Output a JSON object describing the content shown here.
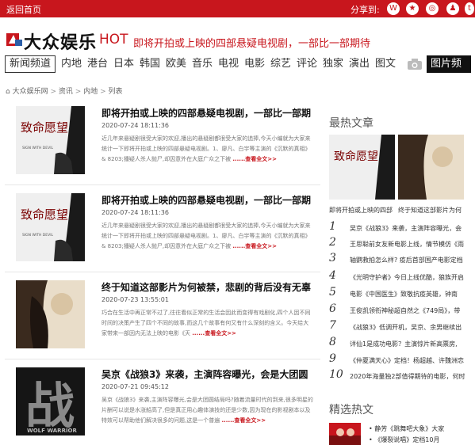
{
  "topbar": {
    "home_label": "返回首页",
    "share_label": "分享到:",
    "share_icons": [
      "weibo-icon",
      "qzone-icon",
      "wechat-icon",
      "qq-icon",
      "tencent-weibo-icon"
    ],
    "brand_color": "#c8161d"
  },
  "brand": {
    "logo_text": "大众娱乐",
    "hot_label": "HOT",
    "hot_title": "即将开拍或上映的四部悬疑电视剧，一部比一部期待"
  },
  "nav": {
    "items": [
      "新闻频道",
      "内地",
      "港台",
      "日本",
      "韩国",
      "欧美",
      "音乐",
      "电视",
      "电影",
      "综艺",
      "评论",
      "独家",
      "演出",
      "图文"
    ],
    "photo_label": "图片频道"
  },
  "breadcrumb": {
    "items": [
      "大众娱乐网",
      "资讯",
      "内地",
      "列表"
    ],
    "separator": ">"
  },
  "articles": [
    {
      "title": "即将开拍或上映的四部悬疑电视剧，一部比一部期",
      "date": "2020-07-24 18:11:36",
      "summary": "近几年来悬疑剧很受大家的欢迎,播出的悬疑剧都很受大家的追捧,今天小编就为大家来统计一下即将开拍或上映的四部悬疑电视剧。1、廖凡、白宇等主演的《沉默的真相》& 8203;播疑人杀人抛尸,却因意外在大庭广众之下被",
      "more": "......查看全文>>",
      "thumb_text": "致命愿望",
      "thumb_sub": "SIGN WITH DEVIL"
    },
    {
      "title": "即将开拍或上映的四部悬疑电视剧，一部比一部期",
      "date": "2020-07-24 18:11:36",
      "summary": "近几年来悬疑剧很受大家的欢迎,播出的悬疑剧都很受大家的追捧,今天小编就为大家来统计一下即将开拍或上映的四部悬疑电视剧。1、廖凡、白宇等主演的《沉默的真相》& 8203;播疑人杀人抛尸,却因意外在大庭广众之下被",
      "more": "......查看全文>>",
      "thumb_text": "致命愿望",
      "thumb_sub": "SIGN WITH DEVIL"
    },
    {
      "title": "终于知道这部影片为何被禁，悲剧的背后没有无辜",
      "date": "2020-07-23 13:55:01",
      "summary": "巧合在生活中再正常不过了,往往看似正常的生活会因此而变得有戏剧化,四个人因不同时间的决策产生了四个不同的故事,而这几个故事有何又有什么深刻的含义。今天给大家带来一部因内无法上映的电影《天",
      "more": "......查看全文>>",
      "thumb_text": "",
      "thumb_sub": ""
    },
    {
      "title": "吴京《战狼3》来袭，主演阵容曝光，会是大团圆",
      "date": "2020-07-21 09:45:12",
      "summary": "吴京《战狼3》来袭,主演阵容曝光,会是大团圆结局吗?随着流量时代的到来,很多明星的片酬可以说是水涨船高了,但是真正用心趣体演技的还是少数,因为现在的影视剧本以及特效可以帮助他们解决很多的问题,这是一个普遍",
      "more": "......查看全文>>",
      "thumb_text": "战",
      "thumb_sub": "WOLF WARRIOR"
    }
  ],
  "sidebar": {
    "hot_title": "最热文章",
    "hot_captions": [
      "即将开拍或上映的四部",
      "终于知道这部影片为何"
    ],
    "ranks": [
      "吴京《战狼3》来袭，主演阵容曝光，会",
      "王思聪前女友新电影上线，情节模仿《雨",
      "轴鹦救拍怎么样? 疫后首部国产电影定档",
      "《光明守护者》今日上线优酷，狼族开启",
      "电影《中国医生》致敬抗疫英雄，钟南",
      "王俊凯领衔神秘超自然之《749局》，带",
      "《战狼3》低调开机，吴京、余男继续出",
      "详仙1是成功电影？主演惊片新高票房,",
      "《仲夏满天心》定档！杨超越、许魏洲恋",
      "2020年海量独2部值得期待的电影，何时"
    ],
    "pick_title": "精选热文",
    "picks": [
      "• 静芳《跳舞吧大象》大家",
      "• 《爆裂说唱》定档10月"
    ]
  }
}
